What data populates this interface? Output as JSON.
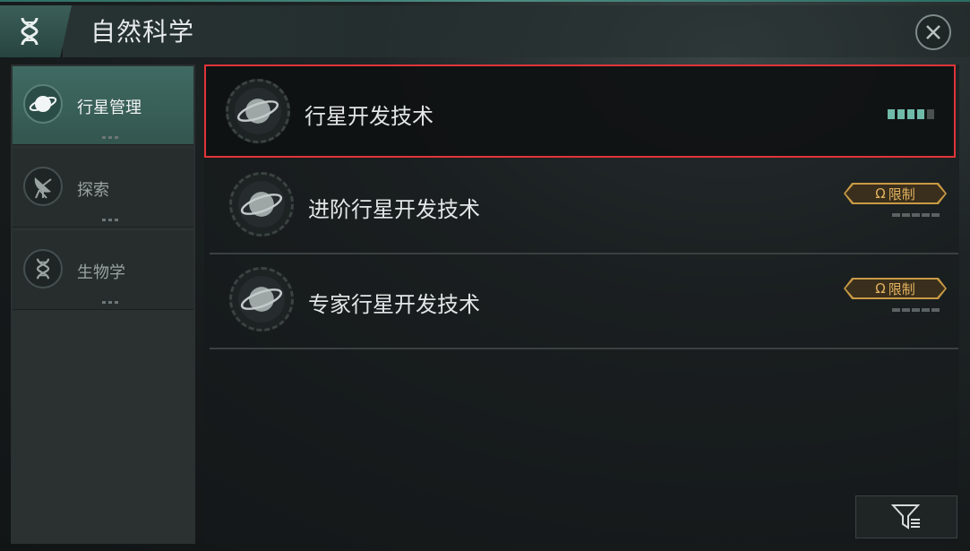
{
  "header": {
    "title": "自然科学",
    "category_icon": "dna-icon",
    "close_icon": "close-icon"
  },
  "sidebar": {
    "items": [
      {
        "label": "行星管理",
        "icon": "planet-icon",
        "active": true
      },
      {
        "label": "探索",
        "icon": "satellite-dish-icon",
        "active": false
      },
      {
        "label": "生物学",
        "icon": "dna-icon",
        "active": false
      }
    ]
  },
  "tech_list": [
    {
      "name": "行星开发技术",
      "icon": "planet-icon",
      "progress": {
        "current": 4,
        "max": 5
      },
      "selected": true
    },
    {
      "name": "进阶行星开发技术",
      "icon": "planet-icon",
      "badge": "限制",
      "badge_symbol": "Ω",
      "progress": {
        "current": 0,
        "max": 5
      }
    },
    {
      "name": "专家行星开发技术",
      "icon": "planet-icon",
      "badge": "限制",
      "badge_symbol": "Ω",
      "progress": {
        "current": 0,
        "max": 5
      }
    }
  ],
  "colors": {
    "accent": "#3f6a63",
    "selection": "#e0353a",
    "badge": "#c99a45",
    "progress_on": "#6fbaa9"
  },
  "filter_icon": "filter-icon"
}
